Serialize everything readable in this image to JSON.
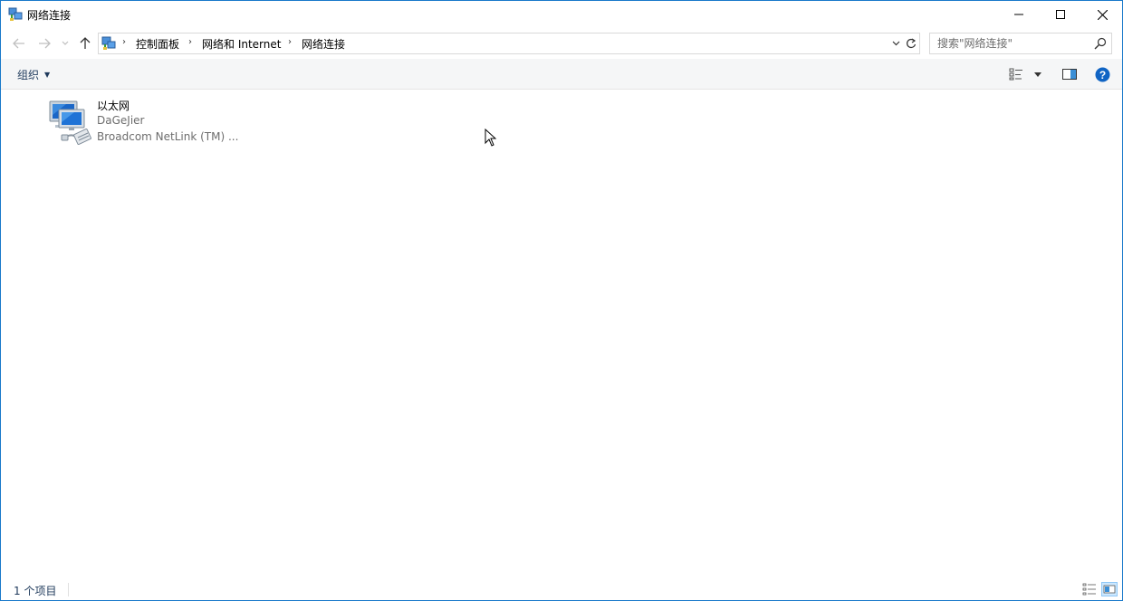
{
  "window": {
    "title": "网络连接",
    "controls": {
      "minimize": "minimize-icon",
      "maximize": "maximize-icon",
      "close": "close-icon"
    }
  },
  "navigation": {
    "breadcrumbs": [
      "控制面板",
      "网络和 Internet",
      "网络连接"
    ],
    "search_placeholder": "搜索\"网络连接\""
  },
  "command_bar": {
    "organize_label": "组织"
  },
  "items": [
    {
      "name": "以太网",
      "line2": "DaGeJier",
      "line3": "Broadcom NetLink (TM) ..."
    }
  ],
  "status_bar": {
    "item_count": "1 个项目"
  },
  "colors": {
    "accent": "#1979ca",
    "link_text": "#1e395b",
    "secondary_text": "#6d6d6d",
    "command_bar_bg": "#f5f6f7"
  }
}
